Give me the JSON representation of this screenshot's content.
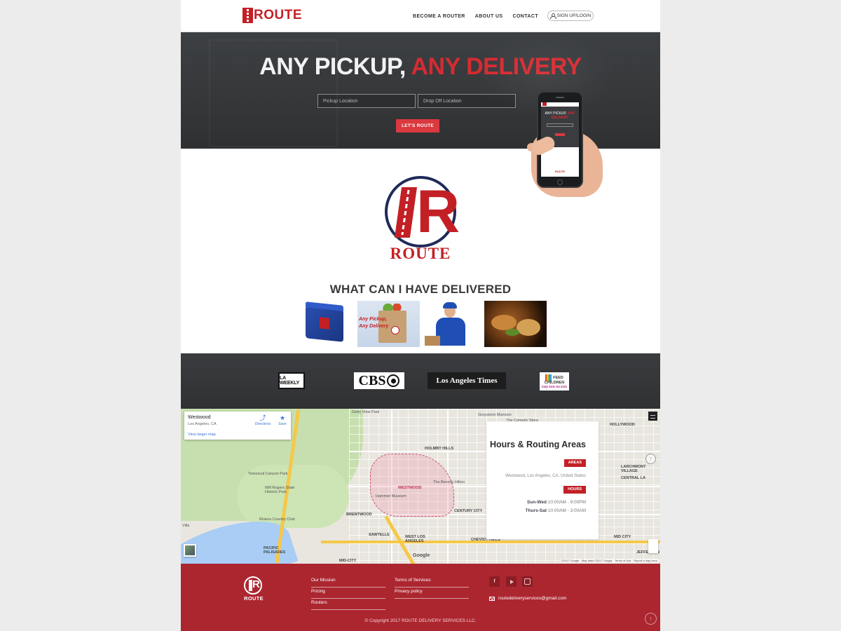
{
  "header": {
    "logo_text": "ROUTE",
    "nav": [
      "BECOME A ROUTER",
      "ABOUT US",
      "CONTACT"
    ],
    "signup_label": "SIGN UP/LOGIN"
  },
  "hero": {
    "title_plain": "ANY PICKUP, ",
    "title_accent": "ANY DELIVERY",
    "pickup_placeholder": "Pickup Location",
    "dropoff_placeholder": "Drop Off Location",
    "cta_label": "LET'S ROUTE",
    "phone_title_plain": "ANY PICKUP, ",
    "phone_title_accent": "ANY DELIVERY",
    "phone_logo": "ROUTE"
  },
  "brand": {
    "big_logo_word": "ROUTE"
  },
  "deliver": {
    "title": "WHAT CAN I HAVE DELIVERED",
    "grocery_text_1": "Any Pickup,",
    "grocery_text_2": "Any Delivery"
  },
  "press": {
    "laweekly": "LA WEEKLY",
    "cbs": "CBS",
    "lat": "Los Angeles Times",
    "feed_1": "FEED",
    "feed_2": "CHILDREN",
    "feed_sub": "help kids be kids"
  },
  "map": {
    "card_place": "Westwood",
    "card_addr": "Los Angeles, CA",
    "card_larger": "View larger map",
    "card_directions": "Directions",
    "card_save": "Save",
    "labels": {
      "getty": "Getty View Park",
      "greystone": "Greystone Mansion",
      "comedy": "The Comedy Store",
      "hollywood": "HOLLYWOOD",
      "holmby": "HOLMBY HILLS",
      "westwood": "WESTWOOD",
      "hilton": "The Beverly Hilton",
      "hammer": "Hammer Museum",
      "brentwood": "BRENTWOOD",
      "century": "CENTURY CITY",
      "temescal": "Temescal Canyon Park",
      "rogers": "Will Rogers State Historic Park",
      "riviera": "Riviera Country Club",
      "sawtelle": "SAWTELLE",
      "westla": "WEST LOS ANGELES",
      "cheviot": "CHEVIOT HILLS",
      "pacific": "PACIFIC PALISADES",
      "midcity_bottom": "MID-CITY",
      "midcity_right": "MID CITY",
      "larchmont": "LARCHMONT VILLAGE",
      "centralla": "CENTRAL LA",
      "jefferson": "JEFFERSON",
      "villa": "Villa"
    },
    "google": "Google",
    "attribution": "©2017 Google · Map data ©2017 Google · Terms of Use · Report a map error"
  },
  "hours": {
    "title": "Hours & Routing Areas",
    "areas_tag": "AREAS",
    "area_value": "Westwood, Los Angeles, CA, United States",
    "hours_tag": "HOURS",
    "row1_day": "Sun-Wed",
    "row1_time": " 10:00AM - 9:00PM",
    "row2_day": "Thurs-Sat",
    "row2_time": " 10:00AM - 3:00AM"
  },
  "footer": {
    "logo_word": "ROUTE",
    "col1": [
      "Our Mission",
      "Pricing",
      "Routers"
    ],
    "col2": [
      "Terms of Services",
      "Privacy policy"
    ],
    "email": "routedeliveryservices@gmail.com",
    "copyright": "© Copyright 2017 ROUTE DELIVERY SERVICES LLC."
  },
  "colors": {
    "brand_red": "#c32026",
    "accent_red": "#d52b31",
    "footer_red": "#ac2630",
    "hero_dark": "#3a3c3f"
  },
  "icons": [
    "person-icon",
    "directions-icon",
    "star-icon",
    "fullscreen-icon",
    "compass-icon",
    "facebook-icon",
    "youtube-icon",
    "instagram-icon",
    "mail-icon",
    "arrow-up-icon"
  ]
}
